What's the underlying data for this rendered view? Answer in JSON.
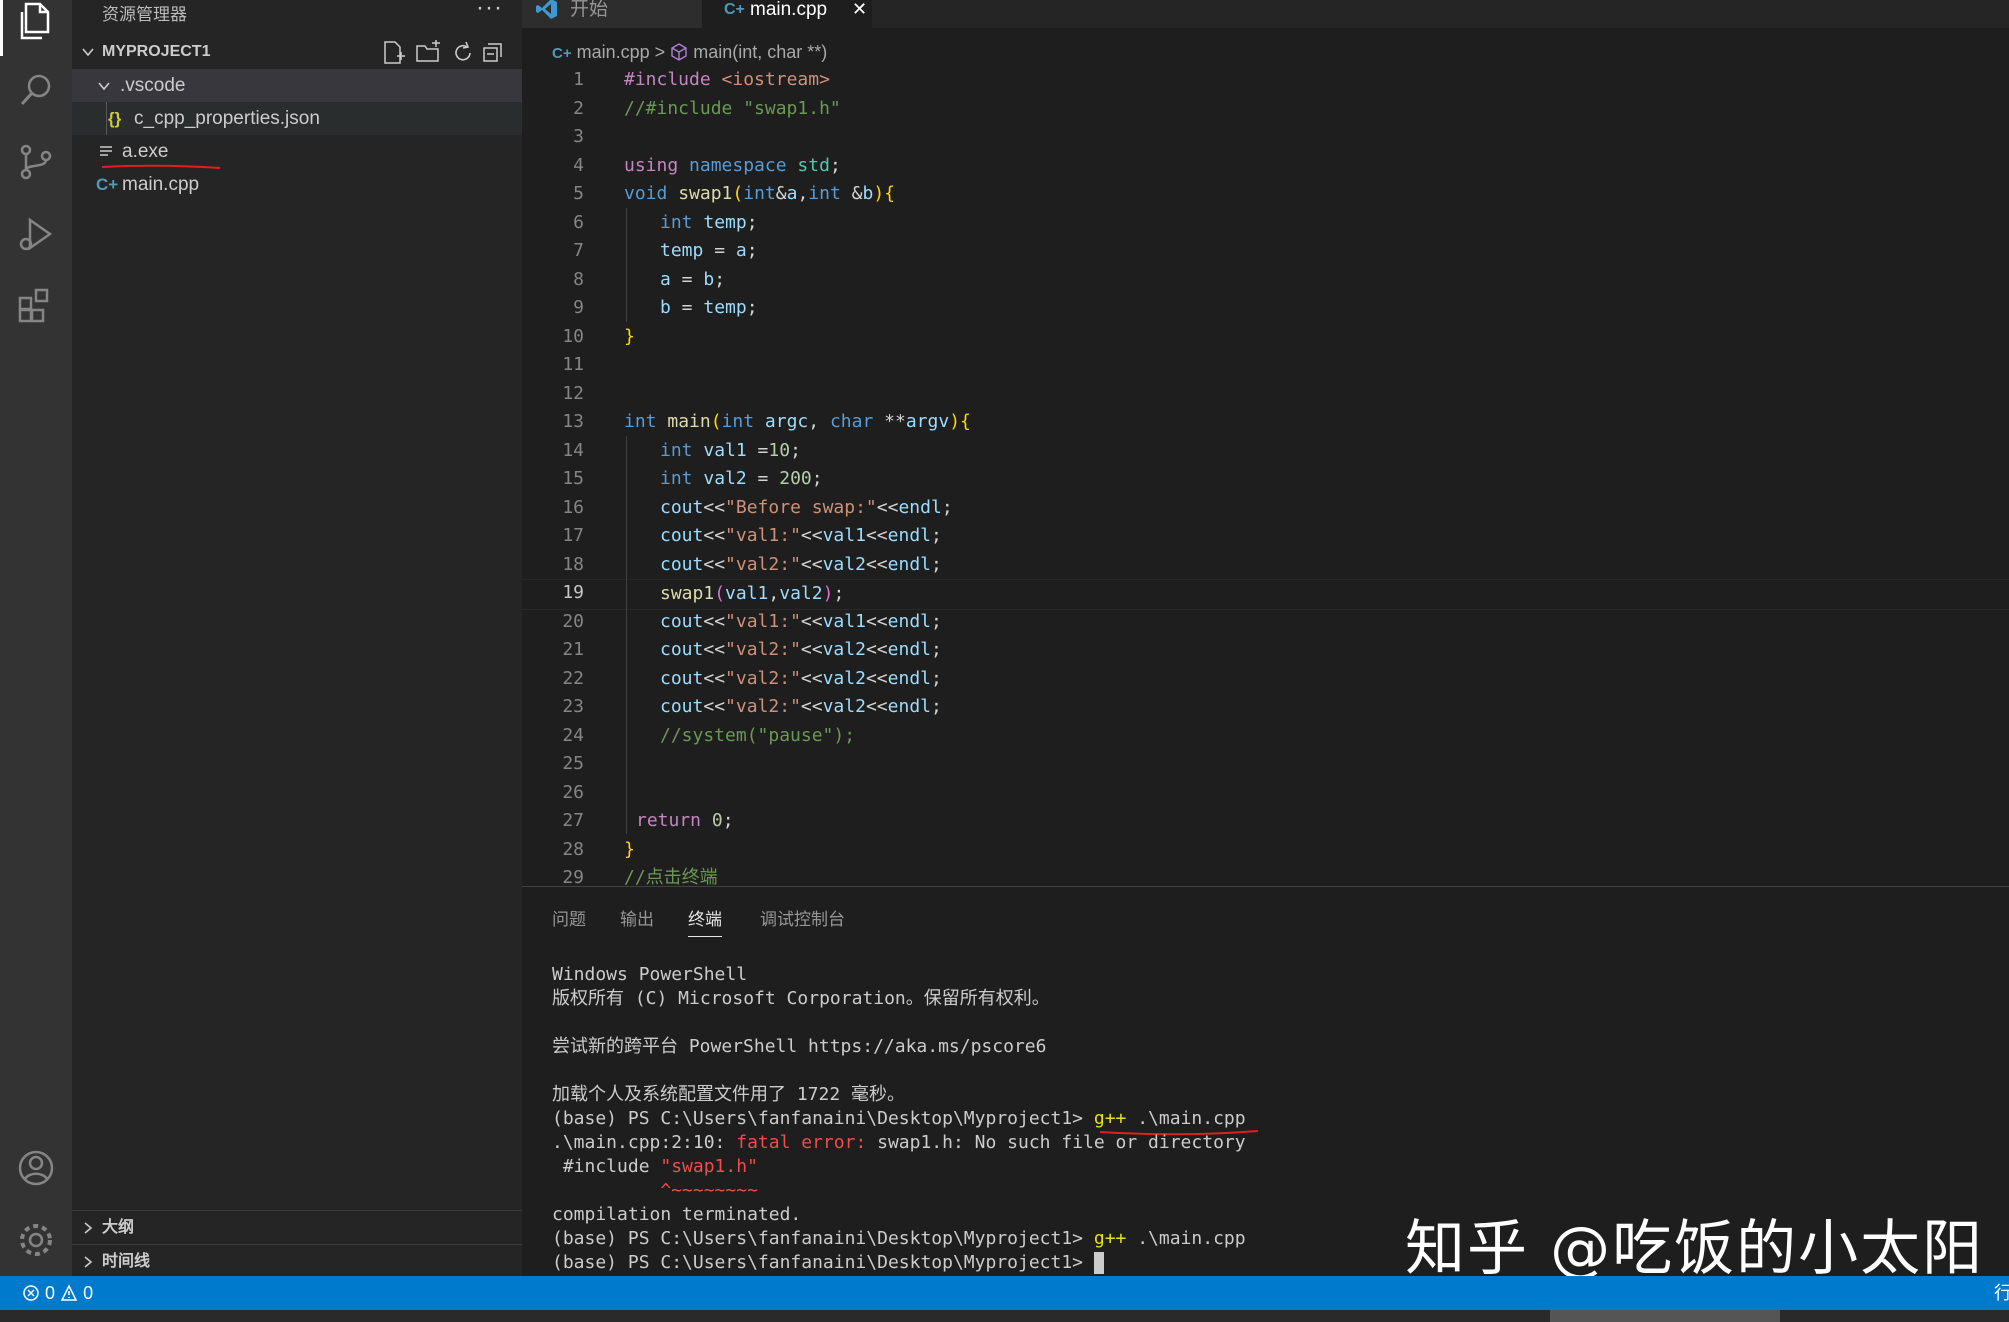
{
  "sidebar": {
    "title": "资源管理器",
    "more": "···",
    "project": "MYPROJECT1",
    "items": [
      {
        "label": ".vscode"
      },
      {
        "label": "c_cpp_properties.json",
        "icon": "{}"
      },
      {
        "label": "a.exe"
      },
      {
        "label": "main.cpp"
      }
    ],
    "outline": "大纲",
    "timeline": "时间线"
  },
  "tabs": [
    {
      "label": "开始"
    },
    {
      "label": "main.cpp",
      "close": "✕"
    }
  ],
  "breadcrumb": {
    "file": "main.cpp",
    "sep": ">",
    "symbol": "main(int, char **)"
  },
  "editor": {
    "current_line": 19,
    "lines": [
      {
        "n": "1"
      },
      {
        "n": "2"
      },
      {
        "n": "3"
      },
      {
        "n": "4"
      },
      {
        "n": "5"
      },
      {
        "n": "6"
      },
      {
        "n": "7"
      },
      {
        "n": "8"
      },
      {
        "n": "9"
      },
      {
        "n": "10"
      },
      {
        "n": "11"
      },
      {
        "n": "12"
      },
      {
        "n": "13"
      },
      {
        "n": "14"
      },
      {
        "n": "15"
      },
      {
        "n": "16"
      },
      {
        "n": "17"
      },
      {
        "n": "18"
      },
      {
        "n": "19"
      },
      {
        "n": "20"
      },
      {
        "n": "21"
      },
      {
        "n": "22"
      },
      {
        "n": "23"
      },
      {
        "n": "24"
      },
      {
        "n": "25"
      },
      {
        "n": "26"
      },
      {
        "n": "27"
      },
      {
        "n": "28"
      },
      {
        "n": "29"
      }
    ],
    "code": {
      "l1": [
        "#include ",
        "<iostream>"
      ],
      "l2": "//#include \"swap1.h\"",
      "l4": [
        "using",
        " ",
        "namespace",
        " ",
        "std",
        ";"
      ],
      "l5": [
        "void",
        " ",
        "swap1",
        "(",
        "int",
        "&",
        "a",
        ",",
        "int",
        " &",
        "b",
        ")",
        "{"
      ],
      "l6": [
        "int",
        " ",
        "temp",
        ";"
      ],
      "l7": [
        "temp",
        " = ",
        "a",
        ";"
      ],
      "l8": [
        "a",
        " = ",
        "b",
        ";"
      ],
      "l9": [
        "b",
        " = ",
        "temp",
        ";"
      ],
      "l10": "}",
      "l13": [
        "int",
        " ",
        "main",
        "(",
        "int",
        " ",
        "argc",
        ", ",
        "char",
        " **",
        "argv",
        ")",
        "{"
      ],
      "l14": [
        "int",
        " ",
        "val1",
        " =",
        "10",
        ";"
      ],
      "l15": [
        "int",
        " ",
        "val2",
        " = ",
        "200",
        ";"
      ],
      "l16": [
        "cout",
        "<<",
        "\"Before swap:\"",
        "<<",
        "endl",
        ";"
      ],
      "l17": [
        "cout",
        "<<",
        "\"val1:\"",
        "<<",
        "val1",
        "<<",
        "endl",
        ";"
      ],
      "l18": [
        "cout",
        "<<",
        "\"val2:\"",
        "<<",
        "val2",
        "<<",
        "endl",
        ";"
      ],
      "l19": [
        "swap1",
        "(",
        "val1",
        ",",
        "val2",
        ")",
        ";"
      ],
      "l20": [
        "cout",
        "<<",
        "\"val1:\"",
        "<<",
        "val1",
        "<<",
        "endl",
        ";"
      ],
      "l21": [
        "cout",
        "<<",
        "\"val2:\"",
        "<<",
        "val2",
        "<<",
        "endl",
        ";"
      ],
      "l22": [
        "cout",
        "<<",
        "\"val2:\"",
        "<<",
        "val2",
        "<<",
        "endl",
        ";"
      ],
      "l23": [
        "cout",
        "<<",
        "\"val2:\"",
        "<<",
        "val2",
        "<<",
        "endl",
        ";"
      ],
      "l24": "//system(\"pause\");",
      "l27": [
        "return",
        " ",
        "0",
        ";"
      ],
      "l28": "}",
      "l29": "//点击终端"
    }
  },
  "panel": {
    "tabs": [
      "问题",
      "输出",
      "终端",
      "调试控制台"
    ],
    "active_tab": "终端",
    "terminal": {
      "t1": "Windows PowerShell",
      "t2": "版权所有 (C) Microsoft Corporation。保留所有权利。",
      "t3": "尝试新的跨平台 PowerShell https://aka.ms/pscore6",
      "t4": "加载个人及系统配置文件用了 1722 毫秒。",
      "prompt": "(base) PS C:\\Users\\fanfanaini\\Desktop\\Myproject1> ",
      "cmd_g": "g++",
      "cmd_rest": " .\\main.cpp",
      "err_loc": ".\\main.cpp:2:10: ",
      "err_fatal": "fatal error: ",
      "err_msg": "swap1.h: No such file or directory",
      "inc_kw": " #include ",
      "inc_str": "\"swap1.h\"",
      "caret": "          ^~~~~~~~~",
      "terminated": "compilation terminated."
    }
  },
  "watermark": "知乎 @吃饭的小太阳",
  "status": {
    "errors": "0",
    "warnings": "0",
    "right": "行"
  },
  "colors": {
    "status_bg": "#007acc",
    "editor_bg": "#1e1e1e",
    "sidebar_bg": "#252526",
    "activity_bg": "#333333"
  }
}
